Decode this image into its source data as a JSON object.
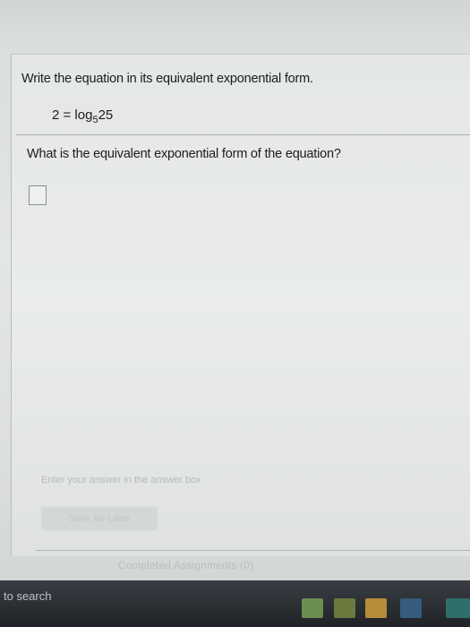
{
  "question": {
    "instruction": "Write the equation in its equivalent exponential form.",
    "equation_left": "2 = log",
    "equation_base": "5",
    "equation_arg": "25",
    "prompt": "What is the equivalent exponential form of the equation?"
  },
  "answer": {
    "value": "",
    "hint": "Enter your answer in the answer box"
  },
  "actions": {
    "save_later_label": "Save for Later"
  },
  "footer": {
    "completed_label": "Completed Assignments (0)"
  },
  "taskbar": {
    "search_text": "to search",
    "icons": [
      "store-icon",
      "file-explorer-icon",
      "shopping-bag-icon",
      "mail-icon",
      "app-icon"
    ]
  }
}
